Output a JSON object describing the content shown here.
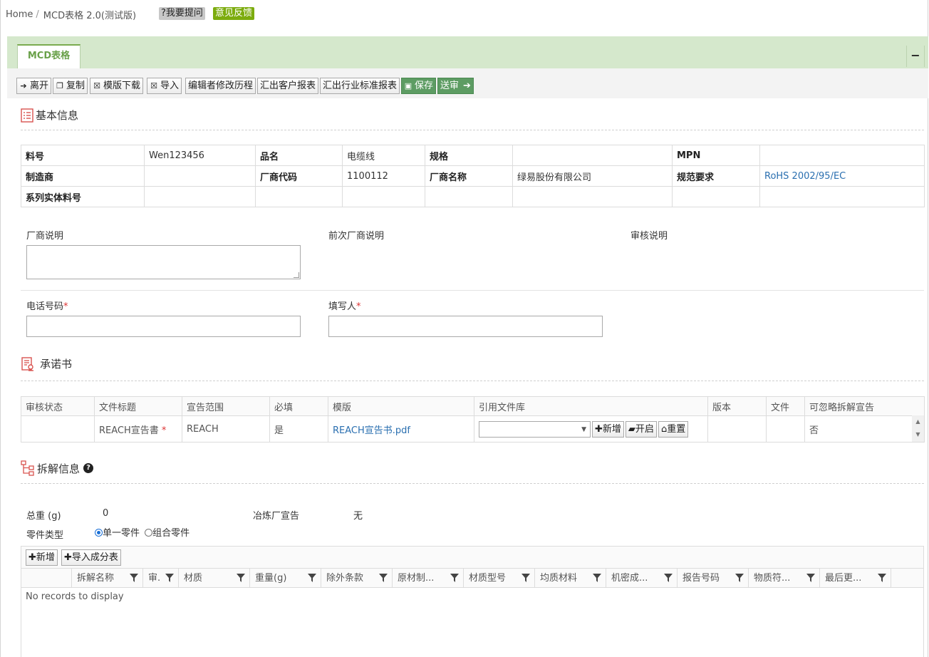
{
  "breadcrumb": {
    "home": "Home",
    "sep": "/",
    "current": "MCD表格 2.0(测试版)"
  },
  "header_buttons": {
    "ask": "?我要提问",
    "feedback": "意见反馈"
  },
  "tab": {
    "label": "MCD表格",
    "minimize": "−",
    "extra": "."
  },
  "toolbar": {
    "leave": "离开",
    "copy": "复制",
    "template_download": "模版下载",
    "import": "导入",
    "edit_history": "编辑者修改历程",
    "export_customer": "汇出客户报表",
    "export_industry": "汇出行业标准报表",
    "save": "保存",
    "submit": "送审"
  },
  "basic_info": {
    "title": "基本信息",
    "rows": [
      [
        "料号",
        "Wen123456",
        "品名",
        "电缆线",
        "规格",
        "",
        "MPN",
        ""
      ],
      [
        "制造商",
        "",
        "厂商代码",
        "1100112",
        "厂商名称",
        "绿易股份有限公司",
        "规范要求",
        "RoHS 2002/95/EC"
      ],
      [
        "系列实体料号",
        "",
        "",
        "",
        "",
        "",
        "",
        ""
      ]
    ],
    "vendor_note_label": "厂商说明",
    "prev_vendor_note_label": "前次厂商说明",
    "review_note_label": "审核说明",
    "phone_label": "电话号码",
    "filler_label": "填写人",
    "required_mark": "*"
  },
  "commitment": {
    "title": "承诺书",
    "headers": [
      "审核状态",
      "文件标题",
      "宣告范围",
      "必填",
      "模版",
      "引用文件库",
      "版本",
      "文件",
      "可忽略拆解宣告"
    ],
    "row": {
      "status": "",
      "file_title": "REACH宣告書",
      "required_star": "*",
      "scope": "REACH",
      "mandatory": "是",
      "template": "REACH宣告书.pdf",
      "library_value": "",
      "version": "",
      "file": "",
      "ignore": "否"
    },
    "buttons": {
      "add": "新增",
      "open": "开启",
      "reset": "重置"
    }
  },
  "disassembly": {
    "title": "拆解信息",
    "total_weight_label": "总重 (g)",
    "total_weight_value": "0",
    "smelter_label": "冶炼厂宣告",
    "smelter_value": "无",
    "part_type_label": "零件类型",
    "part_type_options": [
      "单一零件",
      "组合零件"
    ],
    "part_type_selected": "单一零件",
    "buttons": {
      "add": "新增",
      "import_components": "导入成分表"
    },
    "columns": [
      "拆解名称",
      "审.",
      "材质",
      "重量(g)",
      "除外条款",
      "原材制...",
      "材质型号",
      "均质材料",
      "机密成...",
      "报告号码",
      "物质符...",
      "最后更..."
    ],
    "empty_text": "No records to display"
  }
}
